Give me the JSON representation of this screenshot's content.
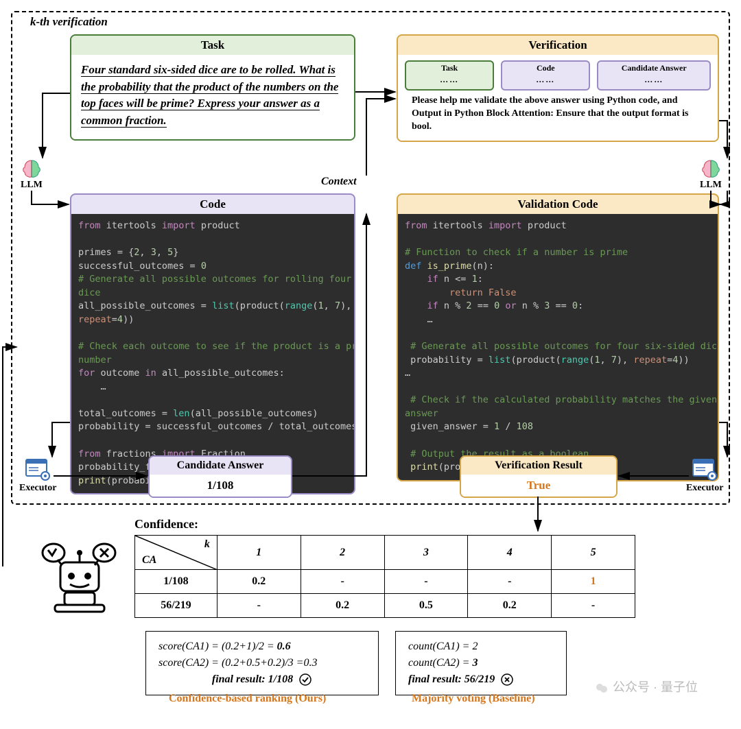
{
  "outer_label": "k-th verification",
  "task": {
    "header": "Task",
    "text": "Four standard six-sided dice are to be rolled. What is the probability that the product of the numbers on the top faces will be prime? Express your answer as a common fraction."
  },
  "llm_label": "LLM",
  "context_label": "Context",
  "code": {
    "header": "Code",
    "lines": [
      {
        "t": "from",
        "c": "kw-pink"
      },
      {
        "t": " itertools ",
        "c": ""
      },
      {
        "t": "import",
        "c": "kw-pink"
      },
      {
        "t": " product",
        "c": ""
      },
      {
        "br": 1
      },
      {
        "br": 1
      },
      {
        "t": "primes = {",
        "c": ""
      },
      {
        "t": "2",
        "c": "kw-num"
      },
      {
        "t": ", ",
        "c": ""
      },
      {
        "t": "3",
        "c": "kw-num"
      },
      {
        "t": ", ",
        "c": ""
      },
      {
        "t": "5",
        "c": "kw-num"
      },
      {
        "t": "}",
        "c": ""
      },
      {
        "br": 1
      },
      {
        "t": "successful_outcomes = ",
        "c": ""
      },
      {
        "t": "0",
        "c": "kw-num"
      },
      {
        "br": 1
      },
      {
        "t": "# Generate all possible outcomes for rolling four six-sided",
        "c": "kw-comment"
      },
      {
        "br": 1
      },
      {
        "t": "dice",
        "c": "kw-comment"
      },
      {
        "br": 1
      },
      {
        "t": "all_possible_outcomes = ",
        "c": ""
      },
      {
        "t": "list",
        "c": "kw-teal"
      },
      {
        "t": "(product(",
        "c": ""
      },
      {
        "t": "range",
        "c": "kw-teal"
      },
      {
        "t": "(",
        "c": ""
      },
      {
        "t": "1",
        "c": "kw-num"
      },
      {
        "t": ", ",
        "c": ""
      },
      {
        "t": "7",
        "c": "kw-num"
      },
      {
        "t": "),",
        "c": ""
      },
      {
        "br": 1
      },
      {
        "t": "repeat",
        "c": "kw-orange"
      },
      {
        "t": "=",
        "c": ""
      },
      {
        "t": "4",
        "c": "kw-num"
      },
      {
        "t": "))",
        "c": ""
      },
      {
        "br": 1
      },
      {
        "br": 1
      },
      {
        "t": "# Check each outcome to see if the product is a prime",
        "c": "kw-comment"
      },
      {
        "br": 1
      },
      {
        "t": "number",
        "c": "kw-comment"
      },
      {
        "br": 1
      },
      {
        "t": "for",
        "c": "kw-pink"
      },
      {
        "t": " outcome ",
        "c": ""
      },
      {
        "t": "in",
        "c": "kw-pink"
      },
      {
        "t": " all_possible_outcomes:",
        "c": ""
      },
      {
        "br": 1
      },
      {
        "t": "    …",
        "c": ""
      },
      {
        "br": 1
      },
      {
        "br": 1
      },
      {
        "t": "total_outcomes = ",
        "c": ""
      },
      {
        "t": "len",
        "c": "kw-teal"
      },
      {
        "t": "(all_possible_outcomes)",
        "c": ""
      },
      {
        "br": 1
      },
      {
        "t": "probability = successful_outcomes / total_outcomes",
        "c": ""
      },
      {
        "br": 1
      },
      {
        "br": 1
      },
      {
        "t": "from",
        "c": "kw-pink"
      },
      {
        "t": " fractions ",
        "c": ""
      },
      {
        "t": "import",
        "c": "kw-pink"
      },
      {
        "t": " Fraction",
        "c": ""
      },
      {
        "br": 1
      },
      {
        "t": "probability_fraction = …",
        "c": ""
      },
      {
        "br": 1
      },
      {
        "t": "print",
        "c": "kw-fn"
      },
      {
        "t": "(probability_fraction)",
        "c": ""
      }
    ]
  },
  "verification": {
    "header": "Verification",
    "mini": {
      "task": "Task",
      "code": "Code",
      "ca": "Candidate Answer",
      "dots": "……"
    },
    "instruction": "Please help me validate the above answer using Python code, and Output in Python Block Attention: Ensure that the output format is bool."
  },
  "validation_code": {
    "header": "Validation Code",
    "lines": [
      {
        "t": "from",
        "c": "kw-pink"
      },
      {
        "t": " itertools ",
        "c": ""
      },
      {
        "t": "import",
        "c": "kw-pink"
      },
      {
        "t": " product",
        "c": ""
      },
      {
        "br": 1
      },
      {
        "br": 1
      },
      {
        "t": "# Function to check if a number is prime",
        "c": "kw-comment"
      },
      {
        "br": 1
      },
      {
        "t": "def ",
        "c": "kw-blue"
      },
      {
        "t": "is_prime",
        "c": "kw-fn"
      },
      {
        "t": "(n):",
        "c": ""
      },
      {
        "br": 1
      },
      {
        "t": "    if",
        "c": "kw-pink"
      },
      {
        "t": " n <= ",
        "c": ""
      },
      {
        "t": "1",
        "c": "kw-num"
      },
      {
        "t": ":",
        "c": ""
      },
      {
        "br": 1
      },
      {
        "t": "        return False",
        "c": "kw-orange"
      },
      {
        "br": 1
      },
      {
        "t": "    if",
        "c": "kw-pink"
      },
      {
        "t": " n % ",
        "c": ""
      },
      {
        "t": "2",
        "c": "kw-num"
      },
      {
        "t": " == ",
        "c": ""
      },
      {
        "t": "0",
        "c": "kw-num"
      },
      {
        "t": " ",
        "c": ""
      },
      {
        "t": "or",
        "c": "kw-pink"
      },
      {
        "t": " n % ",
        "c": ""
      },
      {
        "t": "3",
        "c": "kw-num"
      },
      {
        "t": " == ",
        "c": ""
      },
      {
        "t": "0",
        "c": "kw-num"
      },
      {
        "t": ":",
        "c": ""
      },
      {
        "br": 1
      },
      {
        "t": "    …",
        "c": ""
      },
      {
        "br": 1
      },
      {
        "br": 1
      },
      {
        "t": " # Generate all possible outcomes for four six-sided dice",
        "c": "kw-comment"
      },
      {
        "br": 1
      },
      {
        "t": " probability = ",
        "c": ""
      },
      {
        "t": "list",
        "c": "kw-teal"
      },
      {
        "t": "(product(",
        "c": ""
      },
      {
        "t": "range",
        "c": "kw-teal"
      },
      {
        "t": "(",
        "c": ""
      },
      {
        "t": "1",
        "c": "kw-num"
      },
      {
        "t": ", ",
        "c": ""
      },
      {
        "t": "7",
        "c": "kw-num"
      },
      {
        "t": "), ",
        "c": ""
      },
      {
        "t": "repeat",
        "c": "kw-orange"
      },
      {
        "t": "=",
        "c": ""
      },
      {
        "t": "4",
        "c": "kw-num"
      },
      {
        "t": "))",
        "c": ""
      },
      {
        "br": 1
      },
      {
        "t": "…",
        "c": ""
      },
      {
        "br": 1
      },
      {
        "br": 1
      },
      {
        "t": " # Check if the calculated probability matches the given",
        "c": "kw-comment"
      },
      {
        "br": 1
      },
      {
        "t": "answer",
        "c": "kw-comment"
      },
      {
        "br": 1
      },
      {
        "t": " given_answer = ",
        "c": ""
      },
      {
        "t": "1",
        "c": "kw-num"
      },
      {
        "t": " / ",
        "c": ""
      },
      {
        "t": "108",
        "c": "kw-num"
      },
      {
        "br": 1
      },
      {
        "br": 1
      },
      {
        "t": " # Output the result as a boolean",
        "c": "kw-comment"
      },
      {
        "br": 1
      },
      {
        "t": " print",
        "c": "kw-fn"
      },
      {
        "t": "(probability == given_answer)",
        "c": ""
      }
    ]
  },
  "executor_label": "Executor",
  "candidate_answer": {
    "header": "Candidate Answer",
    "value": "1/108"
  },
  "verification_result": {
    "header": "Verification Result",
    "value": "True"
  },
  "confidence": {
    "label": "Confidence:",
    "k_label": "k",
    "ca_label": "CA",
    "cols": [
      "1",
      "2",
      "3",
      "4",
      "5"
    ],
    "rows": [
      {
        "ca": "1/108",
        "vals": [
          "0.2",
          "-",
          "-",
          "-",
          "1"
        ],
        "hl": 4
      },
      {
        "ca": "56/219",
        "vals": [
          "-",
          "0.2",
          "0.5",
          "0.2",
          "-"
        ],
        "hl": -1
      }
    ]
  },
  "score_ours": {
    "l1": "score(CA1) = (0.2+1)/2 = ",
    "l1b": "0.6",
    "l2": "score(CA2) = (0.2+0.5+0.2)/3 =0.3",
    "l3": "final result:  1/108",
    "label": "Confidence-based ranking  (Ours)"
  },
  "score_base": {
    "l1": "count(CA1) = 2",
    "l2a": "count(CA2) = ",
    "l2b": "3",
    "l3": "final result:  56/219",
    "label": "Majority voting (Baseline)"
  },
  "watermark": "公众号 · 量子位"
}
